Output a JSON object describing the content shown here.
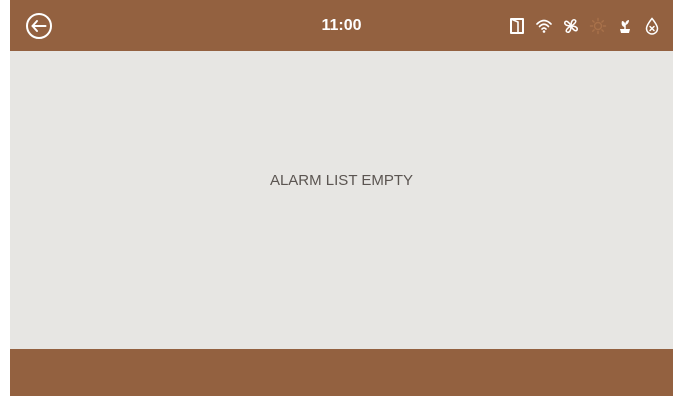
{
  "header": {
    "time": "11:00",
    "back_icon": "back-arrow-icon",
    "status_icons": [
      "door-icon",
      "wifi-icon",
      "fan-icon",
      "sun-icon",
      "plant-icon",
      "water-drop-off-icon"
    ]
  },
  "main": {
    "message": "ALARM LIST EMPTY"
  },
  "colors": {
    "bar": "#936140",
    "background": "#e7e6e3",
    "text": "#5b5551",
    "icon": "#ffffff",
    "icon_inactive": "#a8714a"
  }
}
